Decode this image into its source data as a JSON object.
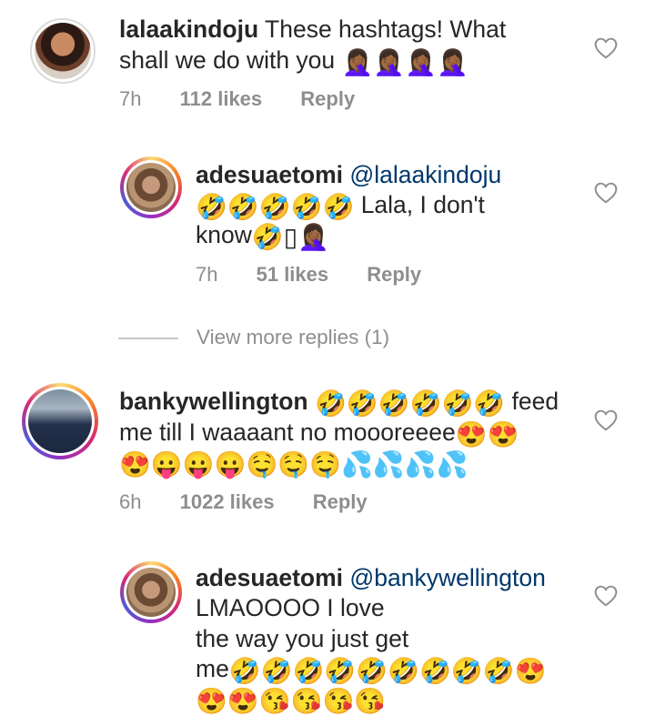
{
  "comments": [
    {
      "username": "lalaakindoju",
      "line1": " These hashtags! What",
      "line2": "shall we do with you ",
      "emojis": "🤦🏾‍♀️🤦🏾‍♀️🤦🏾‍♀️🤦🏾‍♀️",
      "time": "7h",
      "likes": "112 likes",
      "reply": "Reply"
    },
    {
      "username": "adesuaetomi",
      "mention": "@lalaakindoju",
      "emojis1": "🤣🤣🤣🤣🤣",
      "line1": " Lala, I don't",
      "line2": "know",
      "emojis2": "🤣▯🤦🏾‍♀️",
      "time": "7h",
      "likes": "51 likes",
      "reply": "Reply"
    },
    {
      "username": "bankywellington",
      "emojis1": "🤣🤣🤣🤣🤣🤣",
      "line1": " feed",
      "line2": "me till I waaaant no moooreeee",
      "emojis2": "😍😍",
      "emojis3": "😍😛😛😛🤤🤤🤤💦💦💦💦",
      "time": "6h",
      "likes": "1022 likes",
      "reply": "Reply"
    },
    {
      "username": "adesuaetomi",
      "mention": "@bankywellington",
      "line1": "LMAOOOO I love",
      "line2": "the way you just get",
      "line3": "me",
      "emojis1": "🤣🤣🤣🤣🤣🤣🤣🤣🤣😍",
      "emojis2": "😍😍😘😘😘😘"
    }
  ],
  "view_more": "View more replies (1)",
  "icons": {
    "heart": "heart-icon"
  },
  "colors": {
    "text": "#262626",
    "meta": "#8e8e8e",
    "mention": "#00376b"
  }
}
